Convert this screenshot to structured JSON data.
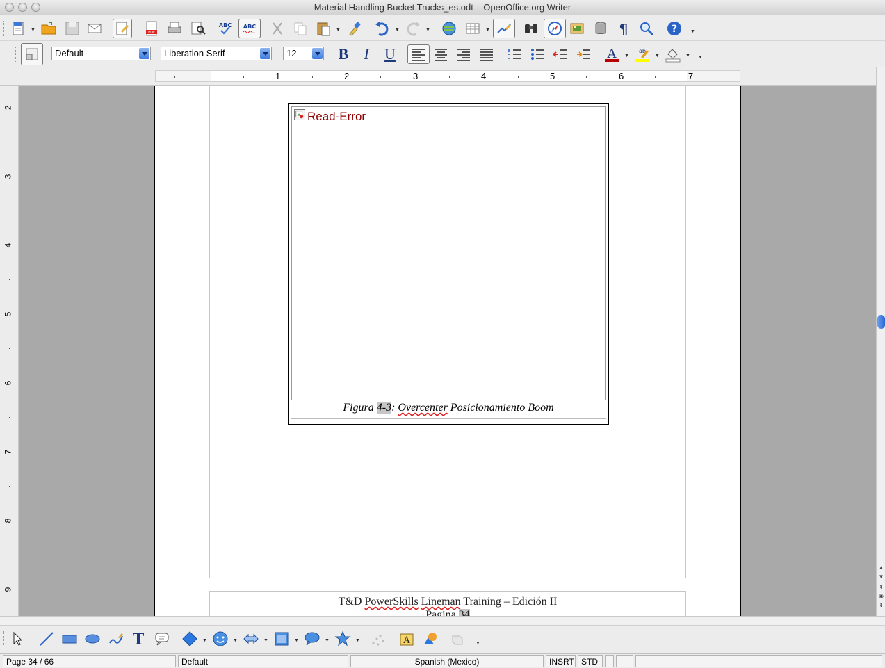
{
  "window": {
    "title": "Material Handling Bucket Trucks_es.odt – OpenOffice.org Writer"
  },
  "formatting": {
    "paragraph_style": "Default",
    "font_name": "Liberation Serif",
    "font_size": "12"
  },
  "ruler": {
    "h_numbers": [
      "1",
      "2",
      "3",
      "4",
      "5",
      "6",
      "7"
    ],
    "v_numbers": [
      "2",
      "3",
      "4",
      "5",
      "6",
      "7",
      "8",
      "9"
    ]
  },
  "document": {
    "frame_error": "Read-Error",
    "caption": {
      "prefix": "Figura ",
      "number": "4-3",
      "sep": ": ",
      "word1": "Overcenter",
      "rest": " Posicionamiento Boom"
    },
    "footer": {
      "line1_a": "T&D ",
      "line1_b": "PowerSkills",
      "line1_c": " ",
      "line1_d": "Lineman",
      "line1_e": " Training – Edición II",
      "line2_a": "Pagina",
      "line2_b": " ",
      "line2_c": "34"
    }
  },
  "statusbar": {
    "page": "Page 34 / 66",
    "page_style": "Default",
    "language": "Spanish (Mexico)",
    "insert_mode": "INSRT",
    "selection_mode": "STD"
  },
  "colors": {
    "accent": "#3f7be0",
    "error_text": "#8b0000"
  }
}
